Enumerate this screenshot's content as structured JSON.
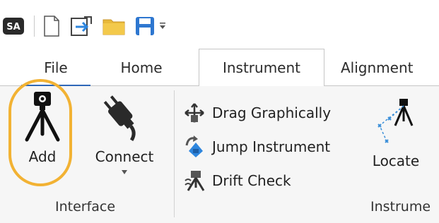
{
  "quick_access": {
    "app_logo": "SA",
    "icons": [
      "new-document-icon",
      "import-icon",
      "open-folder-icon",
      "save-icon",
      "customize-dropdown-icon"
    ]
  },
  "tabs": [
    {
      "label": "File"
    },
    {
      "label": "Home"
    },
    {
      "label": "Instrument"
    },
    {
      "label": "Alignment"
    }
  ],
  "ribbon": {
    "interface_group": {
      "label": "Interface",
      "add_label": "Add",
      "connect_label": "Connect"
    },
    "instrument_group": {
      "label": "Instrume",
      "drag_label": "Drag Graphically",
      "jump_label": "Jump Instrument",
      "drift_label": "Drift Check",
      "locate_label": "Locate"
    }
  },
  "colors": {
    "accent_tab": "#2e67b8",
    "highlight": "#f2b233",
    "ribbon_bg": "#f6f6f6"
  }
}
